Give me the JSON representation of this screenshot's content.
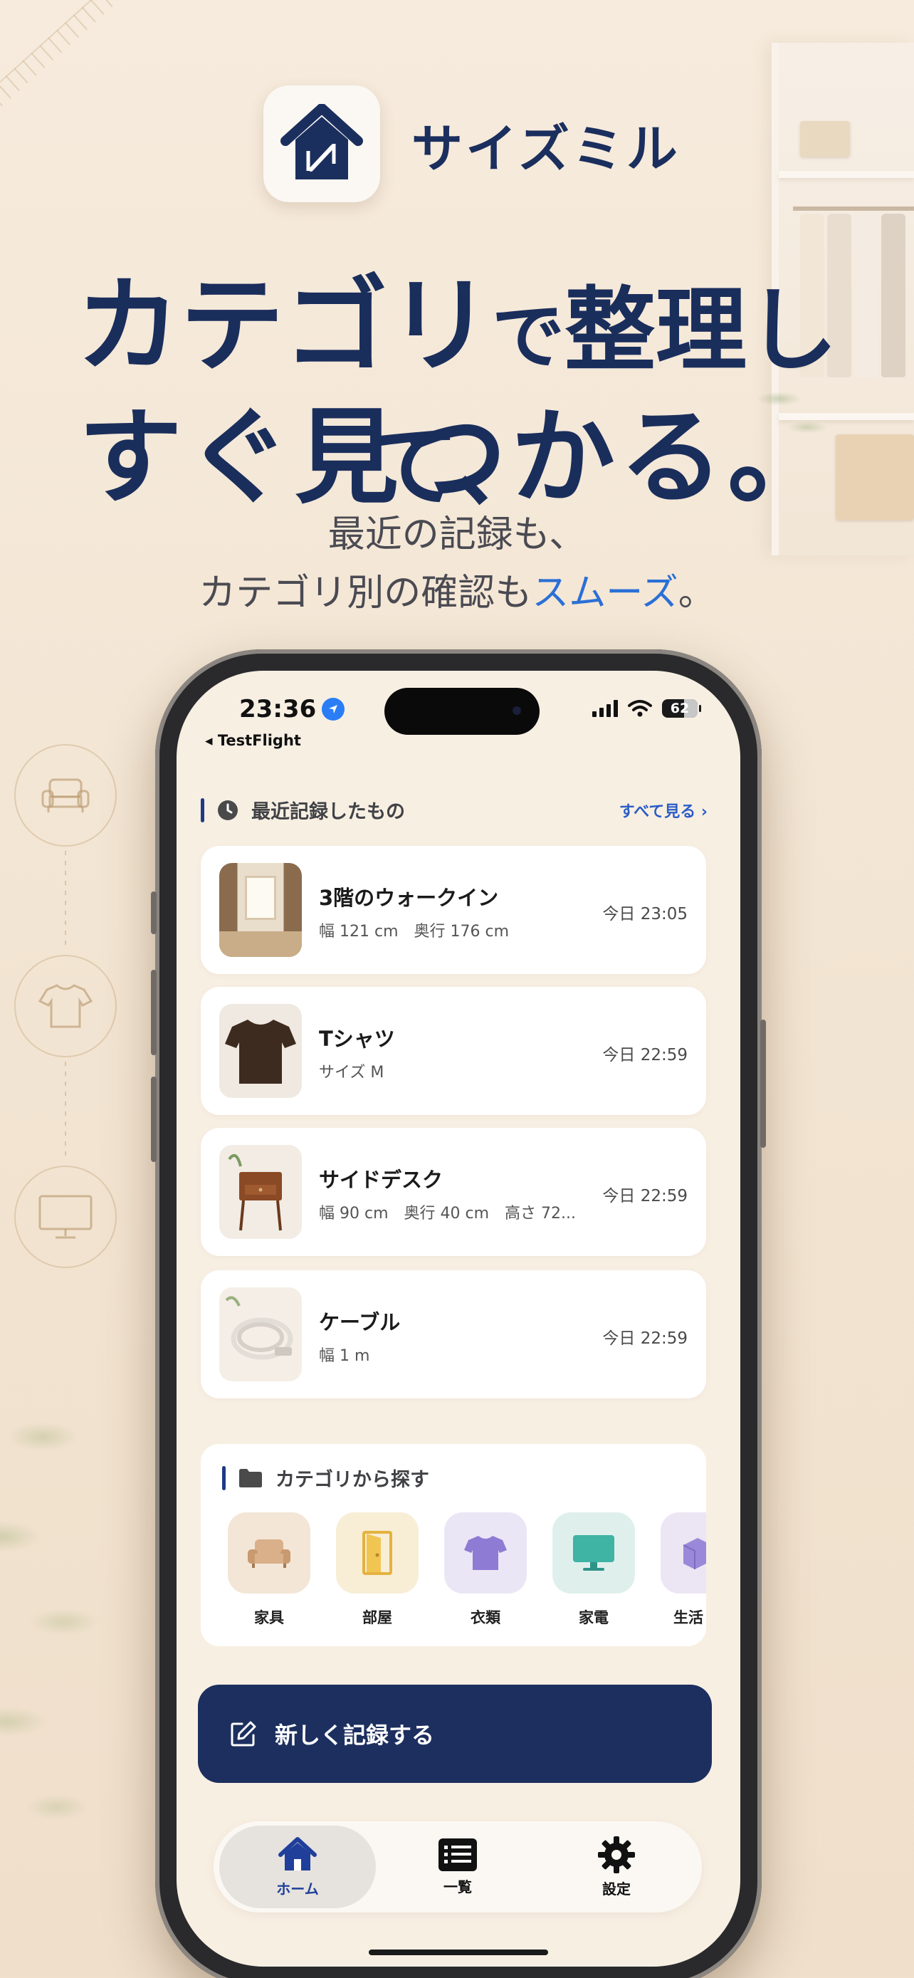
{
  "brand": {
    "name": "サイズミル"
  },
  "headline": {
    "line1_a": "カテゴリ",
    "line1_b": "で",
    "line1_c": "整理して、",
    "line2": "すぐ見つかる。"
  },
  "subtext": {
    "line1": "最近の記録も、",
    "line2_a": "カテゴリ別の確認も",
    "line2_accent": "スムーズ",
    "line2_end": "。"
  },
  "colors": {
    "navy": "#1c2f5f",
    "accent_blue": "#2a6fd6",
    "background": "#f6ebdd"
  },
  "status_bar": {
    "time": "23:36",
    "back_app": "◂ TestFlight",
    "battery": "62"
  },
  "recent": {
    "title": "最近記録したもの",
    "see_all": "すべて見る ›",
    "items": [
      {
        "title": "3階のウォークイン",
        "sub": "幅 121 cm　奥行 176 cm",
        "time": "今日 23:05",
        "thumb": "closet"
      },
      {
        "title": "Tシャツ",
        "sub": "サイズ M",
        "time": "今日 22:59",
        "thumb": "tshirt"
      },
      {
        "title": "サイドデスク",
        "sub": "幅 90 cm　奥行 40 cm　高さ 72...",
        "time": "今日 22:59",
        "thumb": "desk"
      },
      {
        "title": "ケーブル",
        "sub": "幅 1 m",
        "time": "今日 22:59",
        "thumb": "cable"
      }
    ]
  },
  "categories": {
    "title": "カテゴリから探す",
    "items": [
      {
        "label": "家具",
        "icon": "sofa-icon",
        "color": "#f3e6d6"
      },
      {
        "label": "部屋",
        "icon": "door-icon",
        "color": "#f8eed6"
      },
      {
        "label": "衣類",
        "icon": "shirt-icon",
        "color": "#ebe6f5"
      },
      {
        "label": "家電",
        "icon": "monitor-icon",
        "color": "#dff0ec"
      },
      {
        "label": "生活",
        "icon": "box-icon",
        "color": "#ece6f4"
      }
    ]
  },
  "new_record": {
    "label": "新しく記録する"
  },
  "tabs": [
    {
      "label": "ホーム",
      "icon": "home-icon",
      "active": true
    },
    {
      "label": "一覧",
      "icon": "list-icon",
      "active": false
    },
    {
      "label": "設定",
      "icon": "gear-icon",
      "active": false
    }
  ]
}
